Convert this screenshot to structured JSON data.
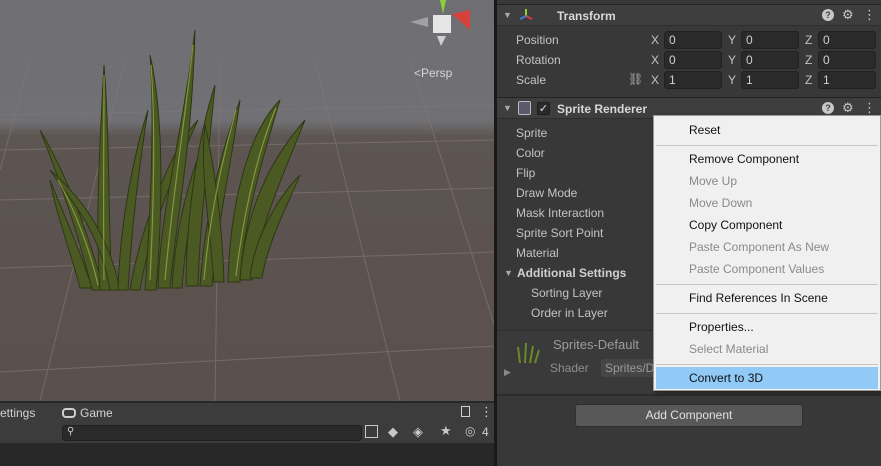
{
  "scene": {
    "persp_label": "<Persp"
  },
  "bottom_panel": {
    "tab_settings": "ettings",
    "tab_game": "Game",
    "search_placeholder": "",
    "visible_count": "4"
  },
  "inspector": {
    "transform": {
      "title": "Transform",
      "rows": [
        {
          "label": "Position",
          "x": "0",
          "y": "0",
          "z": "0"
        },
        {
          "label": "Rotation",
          "x": "0",
          "y": "0",
          "z": "0"
        },
        {
          "label": "Scale",
          "x": "1",
          "y": "1",
          "z": "1"
        }
      ],
      "axis_x": "X",
      "axis_y": "Y",
      "axis_z": "Z"
    },
    "sprite_renderer": {
      "title": "Sprite Renderer",
      "enabled": true,
      "rows": [
        "Sprite",
        "Color",
        "Flip",
        "Draw Mode",
        "Mask Interaction",
        "Sprite Sort Point",
        "Material"
      ],
      "additional_settings": "Additional Settings",
      "sub_rows": [
        "Sorting Layer",
        "Order in Layer"
      ]
    },
    "material": {
      "name": "Sprites-Default",
      "shader_label": "Shader",
      "shader_value": "Sprites/D"
    },
    "add_component": "Add Component"
  },
  "context_menu": {
    "items": [
      {
        "label": "Reset",
        "enabled": true
      },
      {
        "label": "Remove Component",
        "enabled": true
      },
      {
        "label": "Move Up",
        "enabled": false
      },
      {
        "label": "Move Down",
        "enabled": false
      },
      {
        "label": "Copy Component",
        "enabled": true
      },
      {
        "label": "Paste Component As New",
        "enabled": false
      },
      {
        "label": "Paste Component Values",
        "enabled": false
      },
      {
        "label": "Find References In Scene",
        "enabled": true
      },
      {
        "label": "Properties...",
        "enabled": true
      },
      {
        "label": "Select Material",
        "enabled": false
      },
      {
        "label": "Convert to 3D",
        "enabled": true,
        "highlighted": true
      }
    ]
  },
  "colors": {
    "menu_highlight": "#91c9f7",
    "gizmo_x": "#d6413b",
    "gizmo_y": "#8cd13a",
    "gizmo_z": "#3b7fd6"
  }
}
